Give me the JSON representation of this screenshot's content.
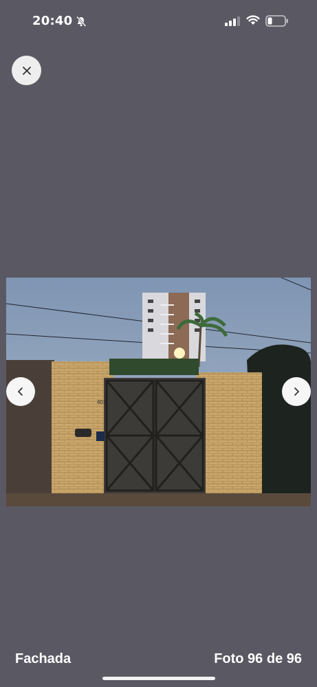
{
  "status_bar": {
    "time": "20:40",
    "icons": [
      "bell-slash-icon",
      "cellular-signal-icon",
      "wifi-icon",
      "battery-icon"
    ]
  },
  "viewer": {
    "close_icon": "close-icon",
    "prev_icon": "chevron-left-icon",
    "next_icon": "chevron-right-icon",
    "caption": "Fachada",
    "counter": "Foto 96 de 96",
    "photo": {
      "house_number": "401"
    }
  },
  "colors": {
    "background": "#5a5963",
    "button_bg": "#eeeeee",
    "text": "#ffffff"
  }
}
